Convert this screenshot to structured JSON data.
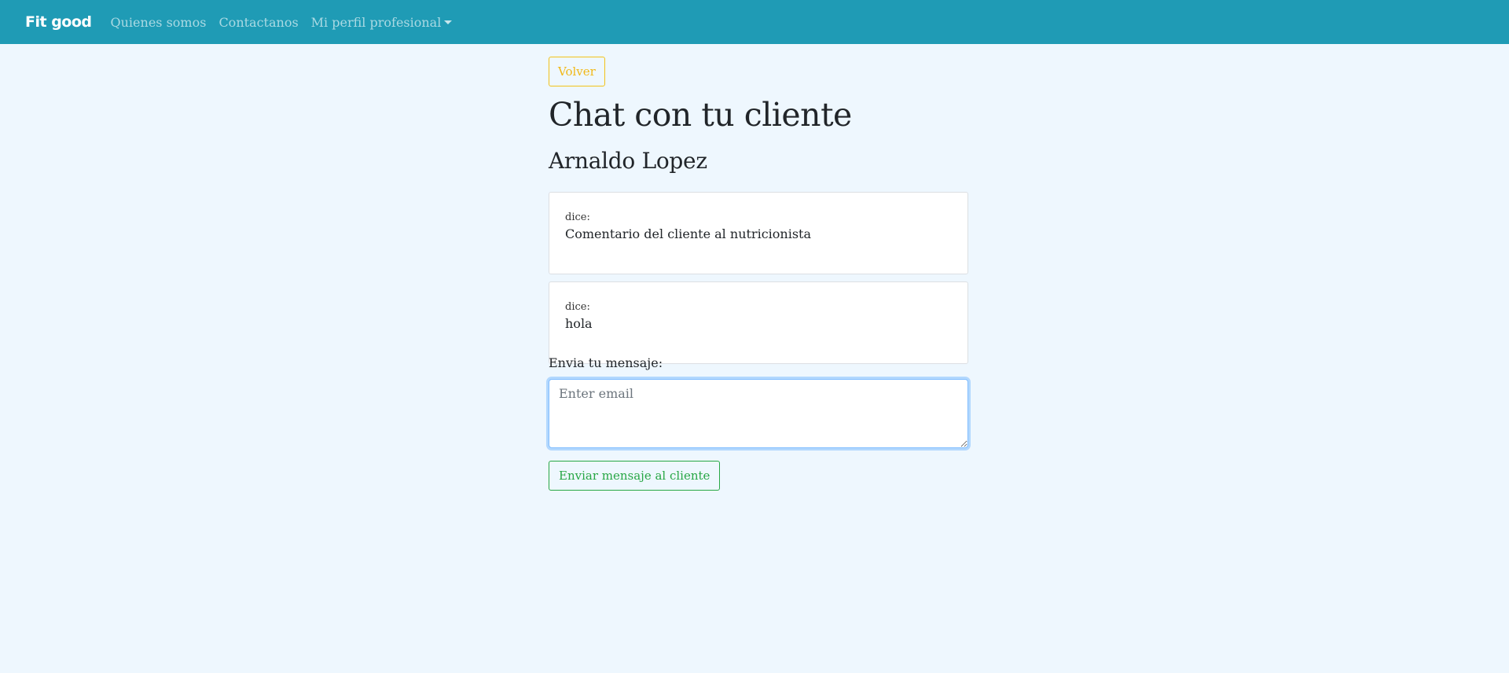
{
  "navbar": {
    "brand": "Fit good",
    "links": [
      {
        "label": "Quienes somos"
      },
      {
        "label": "Contactanos"
      }
    ],
    "dropdown_label": "Mi perfil profesional",
    "background": "#1f9bb5"
  },
  "page": {
    "back_button": "Volver",
    "title": "Chat con tu cliente",
    "client_name": "Arnaldo Lopez",
    "background": "#eef7fe"
  },
  "messages": [
    {
      "author_label": "dice:",
      "text": "Comentario del cliente al nutricionista"
    },
    {
      "author_label": "dice:",
      "text": "hola"
    }
  ],
  "form": {
    "label": "Envia tu mensaje:",
    "value": "",
    "placeholder": "Enter email",
    "submit_label": "Enviar mensaje al cliente"
  },
  "colors": {
    "warning": "#f1b817",
    "success": "#28a745",
    "focus": "#80bdff"
  }
}
